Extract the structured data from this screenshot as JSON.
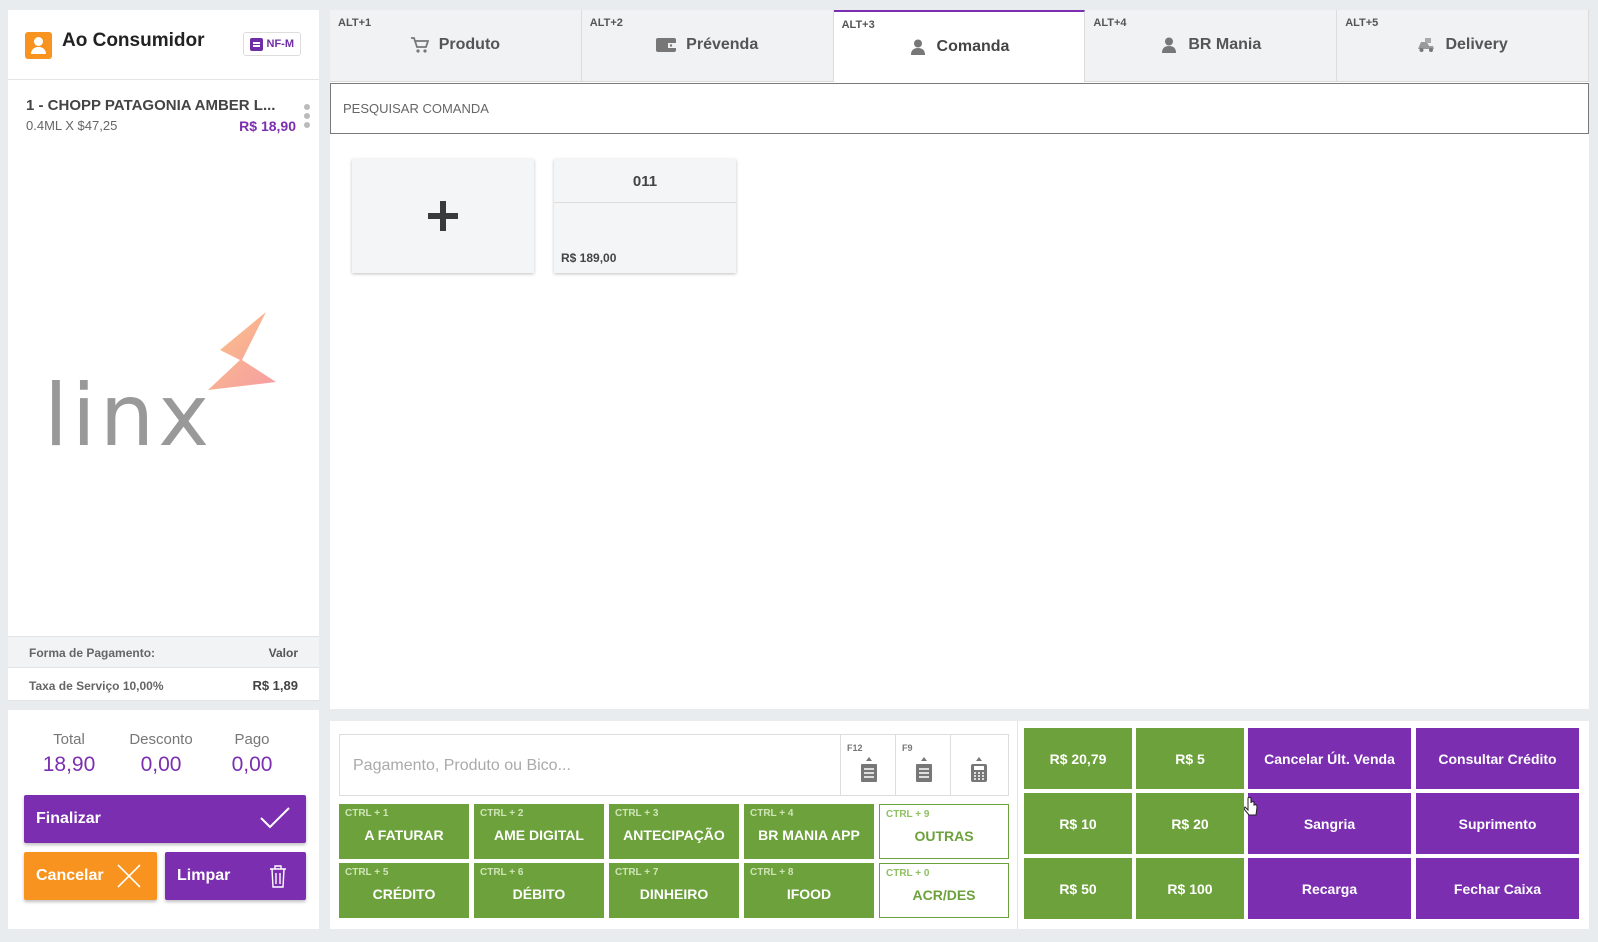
{
  "customer": {
    "name": "Ao Consumidor",
    "badge": "NF-M"
  },
  "cart": {
    "items": [
      {
        "name": "1 - CHOPP PATAGONIA AMBER L...",
        "qty": "0.4ML X $47,25",
        "price": "R$ 18,90"
      }
    ]
  },
  "logo": {
    "text": "linx"
  },
  "payment_summary": {
    "header_label": "Forma de Pagamento:",
    "header_value": "Valor",
    "service_label": "Taxa de Serviço 10,00%",
    "service_value": "R$ 1,89"
  },
  "totals": {
    "total_label": "Total",
    "total_value": "18,90",
    "discount_label": "Desconto",
    "discount_value": "0,00",
    "paid_label": "Pago",
    "paid_value": "0,00"
  },
  "actions": {
    "finalize": "Finalizar",
    "cancel": "Cancelar",
    "clear": "Limpar"
  },
  "tabs": [
    {
      "key": "ALT+1",
      "label": "Produto",
      "icon": "cart-icon"
    },
    {
      "key": "ALT+2",
      "label": "Prévenda",
      "icon": "wallet-icon"
    },
    {
      "key": "ALT+3",
      "label": "Comanda",
      "icon": "person-icon",
      "active": true
    },
    {
      "key": "ALT+4",
      "label": "BR Mania",
      "icon": "person-icon"
    },
    {
      "key": "ALT+5",
      "label": "Delivery",
      "icon": "delivery-icon"
    }
  ],
  "search": {
    "placeholder": "PESQUISAR COMANDA"
  },
  "comandas": [
    {
      "number": "011",
      "value": "R$ 189,00"
    }
  ],
  "payment_input": {
    "placeholder": "Pagamento, Produto ou Bico...",
    "keys": [
      "F12",
      "F9",
      ""
    ]
  },
  "payment_methods": [
    {
      "key": "CTRL + 1",
      "label": "A FATURAR"
    },
    {
      "key": "CTRL + 2",
      "label": "AME DIGITAL"
    },
    {
      "key": "CTRL + 3",
      "label": "ANTECIPAÇÃO"
    },
    {
      "key": "CTRL + 4",
      "label": "BR MANIA APP"
    },
    {
      "key": "CTRL + 9",
      "label": "OUTRAS"
    },
    {
      "key": "CTRL + 5",
      "label": "CRÉDITO"
    },
    {
      "key": "CTRL + 6",
      "label": "DÉBITO"
    },
    {
      "key": "CTRL + 7",
      "label": "DINHEIRO"
    },
    {
      "key": "CTRL + 8",
      "label": "IFOOD"
    },
    {
      "key": "CTRL + 0",
      "label": "ACR/DES"
    }
  ],
  "quick_values": [
    "R$ 20,79",
    "R$ 5",
    "R$ 10",
    "R$ 20",
    "R$ 50",
    "R$ 100"
  ],
  "cash_actions": [
    "Cancelar Últ. Venda",
    "Consultar Crédito",
    "Sangria",
    "Suprimento",
    "Recarga",
    "Fechar Caixa"
  ],
  "colors": {
    "purple": "#7b2fb0",
    "green": "#6da13b",
    "orange": "#f7931e"
  }
}
